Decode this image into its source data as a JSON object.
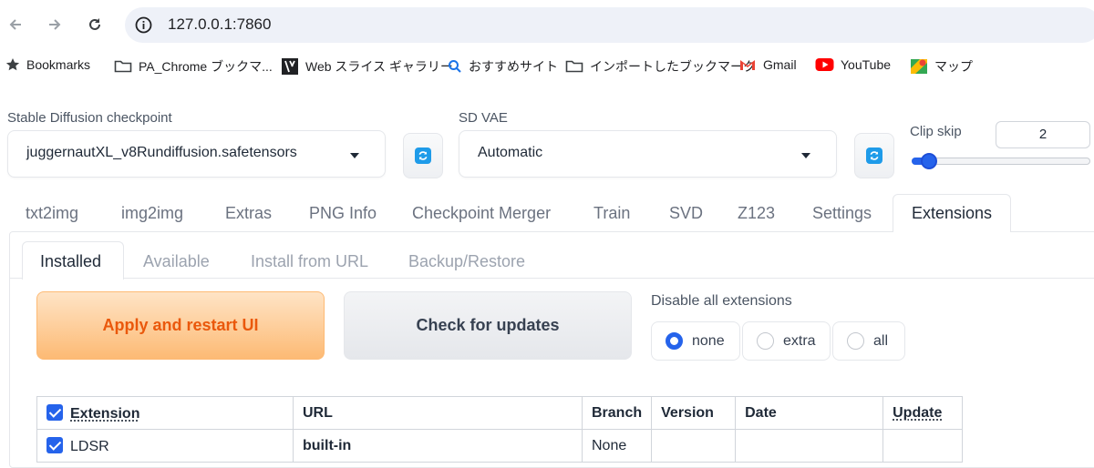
{
  "browser": {
    "url": "127.0.0.1:7860",
    "bookmarks": [
      {
        "label": "Bookmarks",
        "icon": "star-icon"
      },
      {
        "label": "PA_Chrome ブックマ...",
        "icon": "folder-icon"
      },
      {
        "label": "Web スライス ギャラリー",
        "icon": "web-slice-icon"
      },
      {
        "label": "おすすめサイト",
        "icon": "search-icon"
      },
      {
        "label": "インポートしたブックマーク",
        "icon": "folder-icon"
      },
      {
        "label": "Gmail",
        "icon": "gmail-icon"
      },
      {
        "label": "YouTube",
        "icon": "youtube-icon"
      },
      {
        "label": "マップ",
        "icon": "maps-icon"
      }
    ]
  },
  "settings": {
    "checkpoint_label": "Stable Diffusion checkpoint",
    "checkpoint_value": "juggernautXL_v8Rundiffusion.safetensors",
    "vae_label": "SD VAE",
    "vae_value": "Automatic",
    "clip_skip_label": "Clip skip",
    "clip_skip_value": "2"
  },
  "main_tabs": [
    "txt2img",
    "img2img",
    "Extras",
    "PNG Info",
    "Checkpoint Merger",
    "Train",
    "SVD",
    "Z123",
    "Settings",
    "Extensions"
  ],
  "sub_tabs": [
    "Installed",
    "Available",
    "Install from URL",
    "Backup/Restore"
  ],
  "buttons": {
    "apply": "Apply and restart UI",
    "check": "Check for updates"
  },
  "disable": {
    "title": "Disable all extensions",
    "options": [
      "none",
      "extra",
      "all"
    ],
    "selected": "none"
  },
  "table": {
    "headers": [
      "Extension",
      "URL",
      "Branch",
      "Version",
      "Date",
      "Update"
    ],
    "rows": [
      {
        "extension": "LDSR",
        "url": "built-in",
        "branch": "None",
        "version": "",
        "date": "",
        "update": ""
      }
    ]
  },
  "colors": {
    "accent": "#2563eb",
    "apply_text": "#ea580c"
  }
}
